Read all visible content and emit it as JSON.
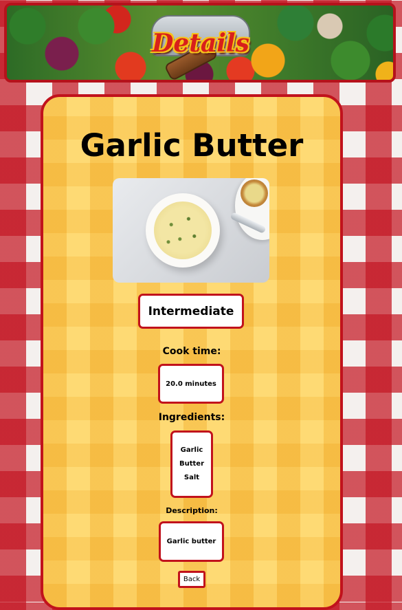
{
  "header": {
    "logo_text": "Details",
    "banner_image": "vegetables-banner"
  },
  "recipe": {
    "title": "Garlic Butter",
    "image": "garlic-butter-bowl-photo",
    "difficulty": "Intermediate",
    "cook_time_label": "Cook time:",
    "cook_time_value": "20.0 minutes",
    "ingredients_label": "Ingredients:",
    "ingredients": [
      "Garlic",
      "Butter",
      "Salt"
    ],
    "description_label": "Description:",
    "description_value": "Garlic butter"
  },
  "actions": {
    "back_label": "Back"
  },
  "colors": {
    "accent_red": "#c1121c",
    "card_yellow": "#fed264"
  }
}
